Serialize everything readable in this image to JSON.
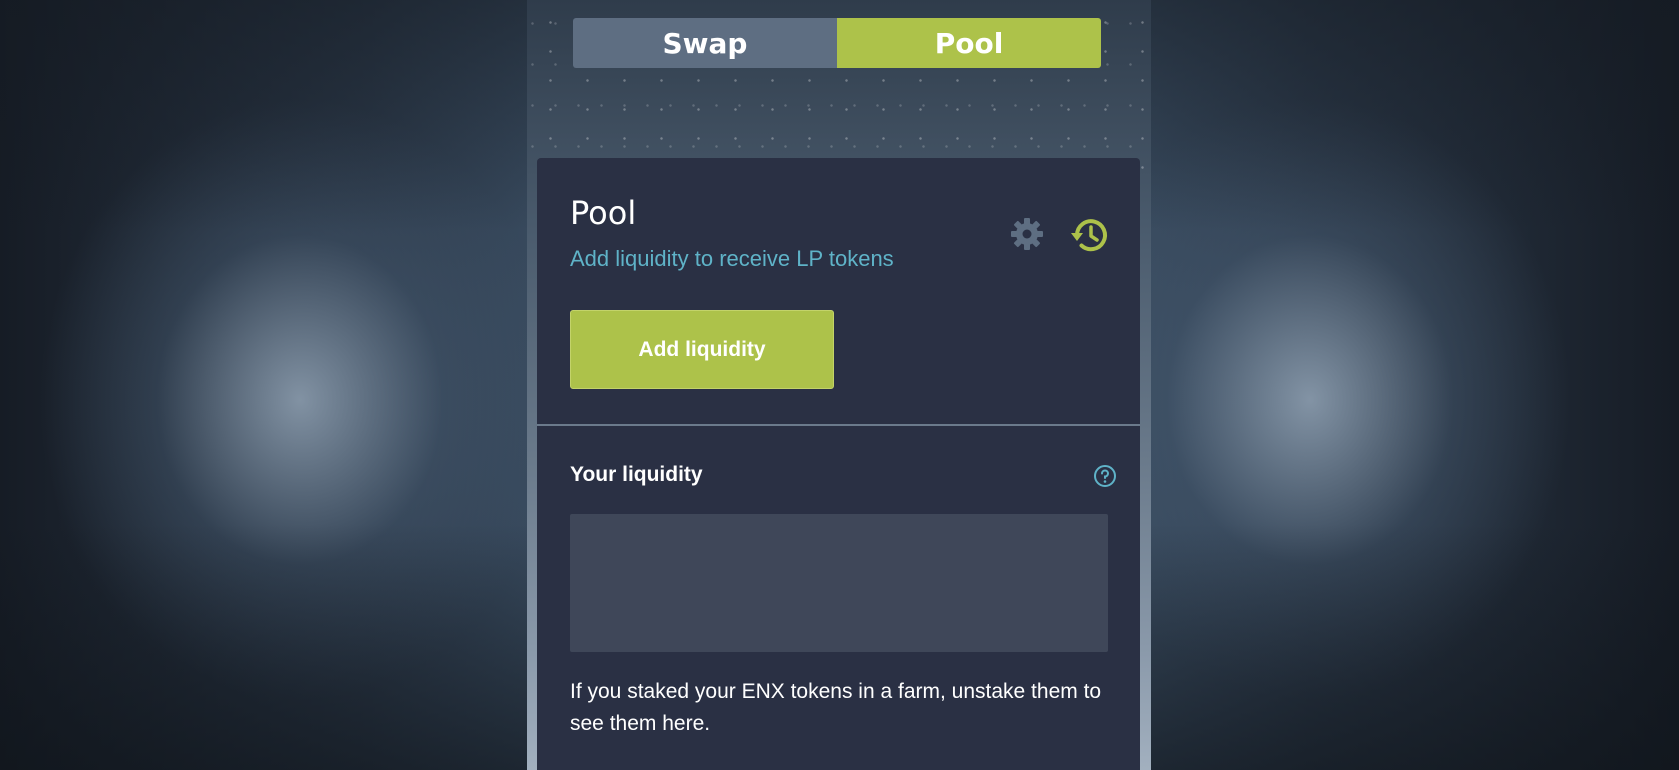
{
  "tabs": [
    {
      "label": "Swap",
      "active": false
    },
    {
      "label": "Pool",
      "active": true
    }
  ],
  "pool_card": {
    "title": "Pool",
    "subtitle": "Add liquidity to receive LP tokens",
    "add_liquidity_label": "Add liquidity",
    "your_liquidity_label": "Your liquidity",
    "note": "If you staked your ENX tokens in a farm, unstake them to see them here."
  },
  "icons": {
    "settings": "gear-icon",
    "history": "history-icon",
    "help": "help-circle-icon"
  },
  "colors": {
    "accent": "#adc24a",
    "tab_inactive": "#5e6e82",
    "card_bg": "#2a3044",
    "link": "#5fb3c8"
  }
}
